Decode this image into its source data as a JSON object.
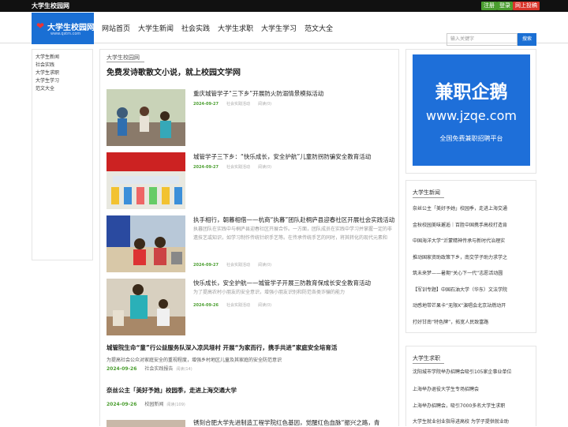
{
  "topbar": {
    "brand": "大学生校园网",
    "register": "注册",
    "login": "登录",
    "submit": "网上投稿"
  },
  "logo": {
    "title": "大学生校园网",
    "subtitle": "www.qstm.com"
  },
  "nav": [
    "网站首页",
    "大学生新闻",
    "社会实践",
    "大学生求职",
    "大学生学习",
    "范文大全"
  ],
  "search": {
    "placeholder": "输入关键字",
    "button": "搜索"
  },
  "sidebar": [
    "大学生新闻",
    "社会实践",
    "大学生求职",
    "大学生学习",
    "范文大全"
  ],
  "main": {
    "crumb": "大学生校园网",
    "heading": "免费发诗歌散文小说，就上校园文学网",
    "articles": [
      {
        "title": "重庆城管学子“三下乡”开展防火防溺情景模拟活动",
        "desc": "",
        "date": "2024-09-27",
        "category": "社会实践活动",
        "views": "阅读(0)"
      },
      {
        "title": "城管学子三下乡：“快乐成长，安全护航”儿童防拐防骗安全教育活动",
        "desc": "",
        "date": "2024-09-27",
        "category": "社会实践活动",
        "views": "阅读(0)"
      },
      {
        "title": "执手相行，朝暮相借——杭商“执暮”团队赴桐庐县迎春社区开展社会实践活动",
        "desc": "执暮团队在实践中与桐庐县迎春社区开展合作。一方面，团队成员在实践中学习并掌握一定的非遗技艺或知识，如学习制作传统针织手艺等。在传承传统手艺的同时，将其转化的现代元素和",
        "date": "2024-09-27",
        "category": "社会实践活动",
        "views": "阅读(0)"
      },
      {
        "title": "快乐成长，安全护航——城管学子开展三防教育保成长安全教育活动",
        "desc": "为了提高农村小朋友的安全意识，增强小朋友识别和防范各类诈骗的能力",
        "date": "2024-09-26",
        "category": "社会实践活动",
        "views": "阅读(0)"
      }
    ],
    "text_articles": [
      {
        "title": "城管院生命“童”行公益服务队深入凉风垭村 开展“为家而行，携手共进”家庭安全培育活",
        "desc": "为提高社会公众对家庭安全的重视程度，增强乡村地区儿童及其家庭的安全防范意识",
        "date": "2024-09-26",
        "category": "社会实践报告",
        "views": "阅读(14)"
      },
      {
        "title": "奈丝公主「美好予她」校园季，走进上海交通大学",
        "desc": "",
        "date": "2024-09-26",
        "category": "校园新闻",
        "views": "阅读(109)"
      }
    ],
    "partial_title": "锈刻合肥大学先进制造工程学院红色基因，觉醒红色血脉“振兴之路，青"
  },
  "ad": {
    "line1": "兼职企鹅",
    "line2": "www.jzqe.com",
    "line3": "全国免费兼职招聘平台"
  },
  "news": {
    "title": "大学生新闻",
    "items": [
      "奈丝公主「美好予她」校园季，走进上海交通",
      "金秋校园美味邂逅｜百胜中国携手高校打造肯",
      "中国海洋大学“沂蒙精神传承与新时代治理实",
      "推动国家资助政策下乡，南交学子助力求学之",
      "筑未来梦——暑期“关心下一代”志愿活动圆",
      "【军训专题】中国石油大学（华东）文法学院",
      "动感地带芒果卡“无限X”演唱会北京站燃动开",
      "打好甘南“特色牌”，拓宽人民致富路"
    ]
  },
  "jobs": {
    "title": "大学生求职",
    "items": [
      "沈阳城市学院举办招聘会吸引105家企事业单位",
      "上海举办退役大学生专场招聘会",
      "上海举办招聘会，吸引7000多名大学生求职",
      "大学生就业创业指导进高校 为学子提供就业助"
    ]
  }
}
